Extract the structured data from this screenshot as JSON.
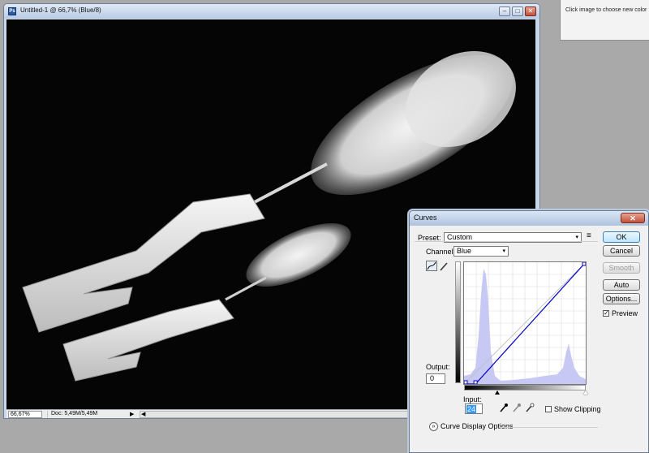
{
  "colors": {
    "curve": "#0000c8",
    "histogram": "#c8c8f5",
    "accent": "#3c7fb1"
  },
  "color_panel": {
    "hint": "Click image to choose new color"
  },
  "document": {
    "title": "Untitled-1 @ 66,7% (Blue/8)",
    "app_icon": "Ps",
    "controls": {
      "minimize": "–",
      "maximize": "□",
      "close": "✕"
    },
    "status": {
      "zoom": "66,67%",
      "doc_info": "Doc: 5,49M/5,49M",
      "menu_arrow": "▶",
      "scroll_left": "◀",
      "scroll_right": "▶"
    }
  },
  "curves": {
    "title": "Curves",
    "close": "✕",
    "preset_label": "Preset:",
    "preset_value": "Custom",
    "preset_menu": "≡",
    "channel_label": "Channel:",
    "channel_value": "Blue",
    "dropdown_arrow": "▾",
    "output_label": "Output:",
    "output_value": "0",
    "input_label": "Input:",
    "input_value": "24",
    "buttons": {
      "ok": "OK",
      "cancel": "Cancel",
      "smooth": "Smooth",
      "auto": "Auto",
      "options": "Options..."
    },
    "preview_label": "Preview",
    "preview_checked": "✓",
    "show_clipping_label": "Show Clipping",
    "display_options_label": "Curve Display Options",
    "expander": "»",
    "curve_points": [
      [
        0,
        0
      ],
      [
        24,
        0
      ],
      [
        255,
        255
      ]
    ]
  }
}
